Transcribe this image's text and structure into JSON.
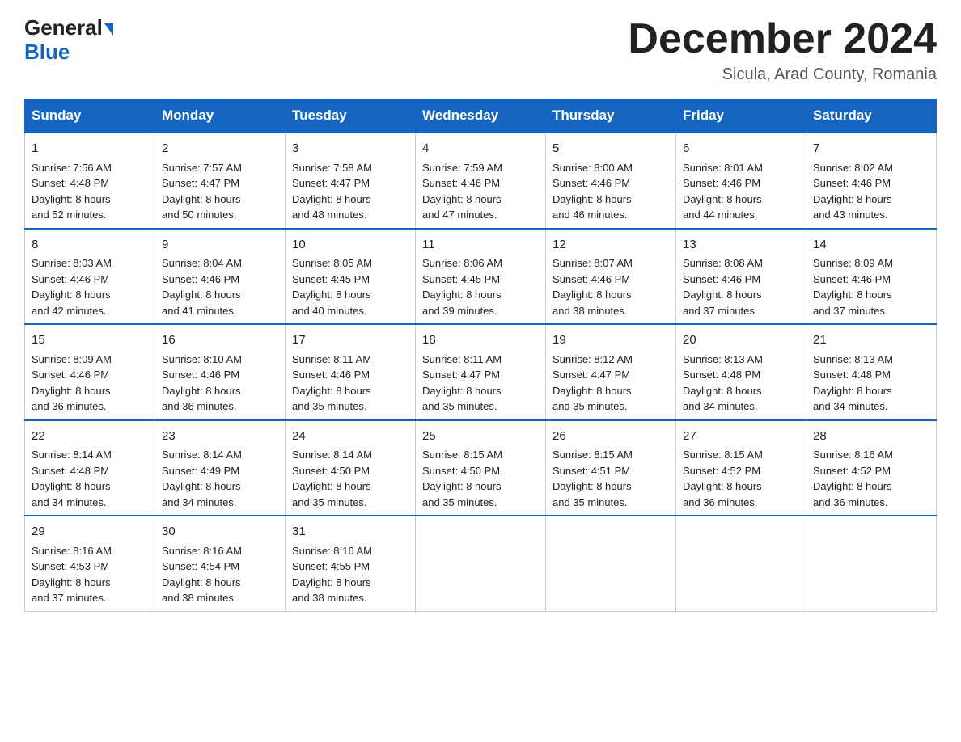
{
  "header": {
    "logo_general": "General",
    "logo_blue": "Blue",
    "title": "December 2024",
    "subtitle": "Sicula, Arad County, Romania"
  },
  "days_of_week": [
    "Sunday",
    "Monday",
    "Tuesday",
    "Wednesday",
    "Thursday",
    "Friday",
    "Saturday"
  ],
  "weeks": [
    [
      {
        "day": "1",
        "sunrise": "7:56 AM",
        "sunset": "4:48 PM",
        "daylight": "8 hours and 52 minutes."
      },
      {
        "day": "2",
        "sunrise": "7:57 AM",
        "sunset": "4:47 PM",
        "daylight": "8 hours and 50 minutes."
      },
      {
        "day": "3",
        "sunrise": "7:58 AM",
        "sunset": "4:47 PM",
        "daylight": "8 hours and 48 minutes."
      },
      {
        "day": "4",
        "sunrise": "7:59 AM",
        "sunset": "4:46 PM",
        "daylight": "8 hours and 47 minutes."
      },
      {
        "day": "5",
        "sunrise": "8:00 AM",
        "sunset": "4:46 PM",
        "daylight": "8 hours and 46 minutes."
      },
      {
        "day": "6",
        "sunrise": "8:01 AM",
        "sunset": "4:46 PM",
        "daylight": "8 hours and 44 minutes."
      },
      {
        "day": "7",
        "sunrise": "8:02 AM",
        "sunset": "4:46 PM",
        "daylight": "8 hours and 43 minutes."
      }
    ],
    [
      {
        "day": "8",
        "sunrise": "8:03 AM",
        "sunset": "4:46 PM",
        "daylight": "8 hours and 42 minutes."
      },
      {
        "day": "9",
        "sunrise": "8:04 AM",
        "sunset": "4:46 PM",
        "daylight": "8 hours and 41 minutes."
      },
      {
        "day": "10",
        "sunrise": "8:05 AM",
        "sunset": "4:45 PM",
        "daylight": "8 hours and 40 minutes."
      },
      {
        "day": "11",
        "sunrise": "8:06 AM",
        "sunset": "4:45 PM",
        "daylight": "8 hours and 39 minutes."
      },
      {
        "day": "12",
        "sunrise": "8:07 AM",
        "sunset": "4:46 PM",
        "daylight": "8 hours and 38 minutes."
      },
      {
        "day": "13",
        "sunrise": "8:08 AM",
        "sunset": "4:46 PM",
        "daylight": "8 hours and 37 minutes."
      },
      {
        "day": "14",
        "sunrise": "8:09 AM",
        "sunset": "4:46 PM",
        "daylight": "8 hours and 37 minutes."
      }
    ],
    [
      {
        "day": "15",
        "sunrise": "8:09 AM",
        "sunset": "4:46 PM",
        "daylight": "8 hours and 36 minutes."
      },
      {
        "day": "16",
        "sunrise": "8:10 AM",
        "sunset": "4:46 PM",
        "daylight": "8 hours and 36 minutes."
      },
      {
        "day": "17",
        "sunrise": "8:11 AM",
        "sunset": "4:46 PM",
        "daylight": "8 hours and 35 minutes."
      },
      {
        "day": "18",
        "sunrise": "8:11 AM",
        "sunset": "4:47 PM",
        "daylight": "8 hours and 35 minutes."
      },
      {
        "day": "19",
        "sunrise": "8:12 AM",
        "sunset": "4:47 PM",
        "daylight": "8 hours and 35 minutes."
      },
      {
        "day": "20",
        "sunrise": "8:13 AM",
        "sunset": "4:48 PM",
        "daylight": "8 hours and 34 minutes."
      },
      {
        "day": "21",
        "sunrise": "8:13 AM",
        "sunset": "4:48 PM",
        "daylight": "8 hours and 34 minutes."
      }
    ],
    [
      {
        "day": "22",
        "sunrise": "8:14 AM",
        "sunset": "4:48 PM",
        "daylight": "8 hours and 34 minutes."
      },
      {
        "day": "23",
        "sunrise": "8:14 AM",
        "sunset": "4:49 PM",
        "daylight": "8 hours and 34 minutes."
      },
      {
        "day": "24",
        "sunrise": "8:14 AM",
        "sunset": "4:50 PM",
        "daylight": "8 hours and 35 minutes."
      },
      {
        "day": "25",
        "sunrise": "8:15 AM",
        "sunset": "4:50 PM",
        "daylight": "8 hours and 35 minutes."
      },
      {
        "day": "26",
        "sunrise": "8:15 AM",
        "sunset": "4:51 PM",
        "daylight": "8 hours and 35 minutes."
      },
      {
        "day": "27",
        "sunrise": "8:15 AM",
        "sunset": "4:52 PM",
        "daylight": "8 hours and 36 minutes."
      },
      {
        "day": "28",
        "sunrise": "8:16 AM",
        "sunset": "4:52 PM",
        "daylight": "8 hours and 36 minutes."
      }
    ],
    [
      {
        "day": "29",
        "sunrise": "8:16 AM",
        "sunset": "4:53 PM",
        "daylight": "8 hours and 37 minutes."
      },
      {
        "day": "30",
        "sunrise": "8:16 AM",
        "sunset": "4:54 PM",
        "daylight": "8 hours and 38 minutes."
      },
      {
        "day": "31",
        "sunrise": "8:16 AM",
        "sunset": "4:55 PM",
        "daylight": "8 hours and 38 minutes."
      },
      null,
      null,
      null,
      null
    ]
  ],
  "labels": {
    "sunrise": "Sunrise: ",
    "sunset": "Sunset: ",
    "daylight": "Daylight: "
  }
}
